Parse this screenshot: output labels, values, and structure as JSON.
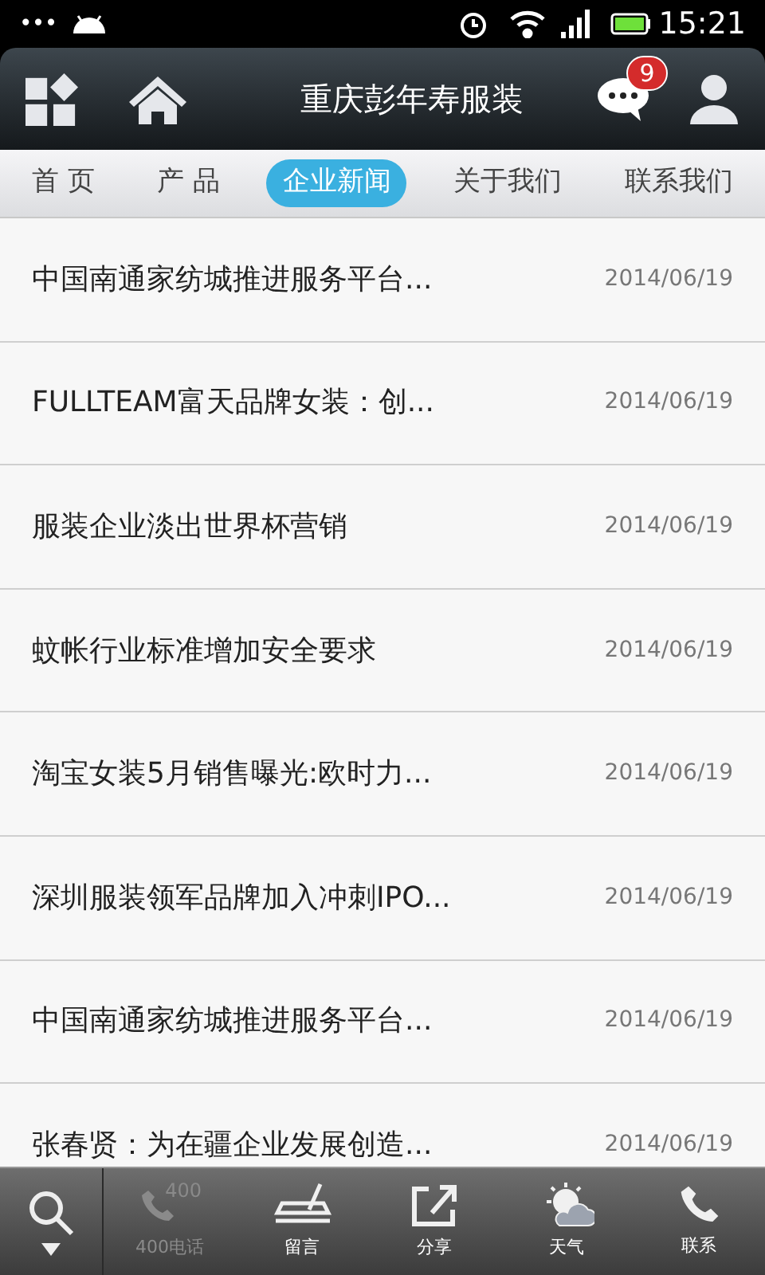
{
  "status_bar": {
    "time": "15:21",
    "notification_dots": "•••"
  },
  "header": {
    "title": "重庆彭年寿服装",
    "message_badge": "9"
  },
  "tabs": [
    {
      "label": "首 页",
      "selected": false
    },
    {
      "label": "产 品",
      "selected": false
    },
    {
      "label": "企业新闻",
      "selected": true
    },
    {
      "label": "关于我们",
      "selected": false
    },
    {
      "label": "联系我们",
      "selected": false
    }
  ],
  "news": [
    {
      "title": "中国南通家纺城推进服务平台...",
      "date": "2014/06/19"
    },
    {
      "title": "FULLTEAM富天品牌女装：创...",
      "date": "2014/06/19"
    },
    {
      "title": "服装企业淡出世界杯营销",
      "date": "2014/06/19"
    },
    {
      "title": "蚊帐行业标准增加安全要求",
      "date": "2014/06/19"
    },
    {
      "title": "淘宝女装5月销售曝光:欧时力...",
      "date": "2014/06/19"
    },
    {
      "title": "深圳服装领军品牌加入冲刺IPO...",
      "date": "2014/06/19"
    },
    {
      "title": "中国南通家纺城推进服务平台...",
      "date": "2014/06/19"
    },
    {
      "title": "张春贤：为在疆企业发展创造...",
      "date": "2014/06/19"
    }
  ],
  "bottom_bar": [
    {
      "kind": "phone400",
      "label": "400电话",
      "icon_text": "400",
      "disabled": true
    },
    {
      "kind": "message",
      "label": "留言",
      "disabled": false
    },
    {
      "kind": "share",
      "label": "分享",
      "disabled": false
    },
    {
      "kind": "weather",
      "label": "天气",
      "disabled": false
    },
    {
      "kind": "phone",
      "label": "联系",
      "disabled": false
    }
  ]
}
